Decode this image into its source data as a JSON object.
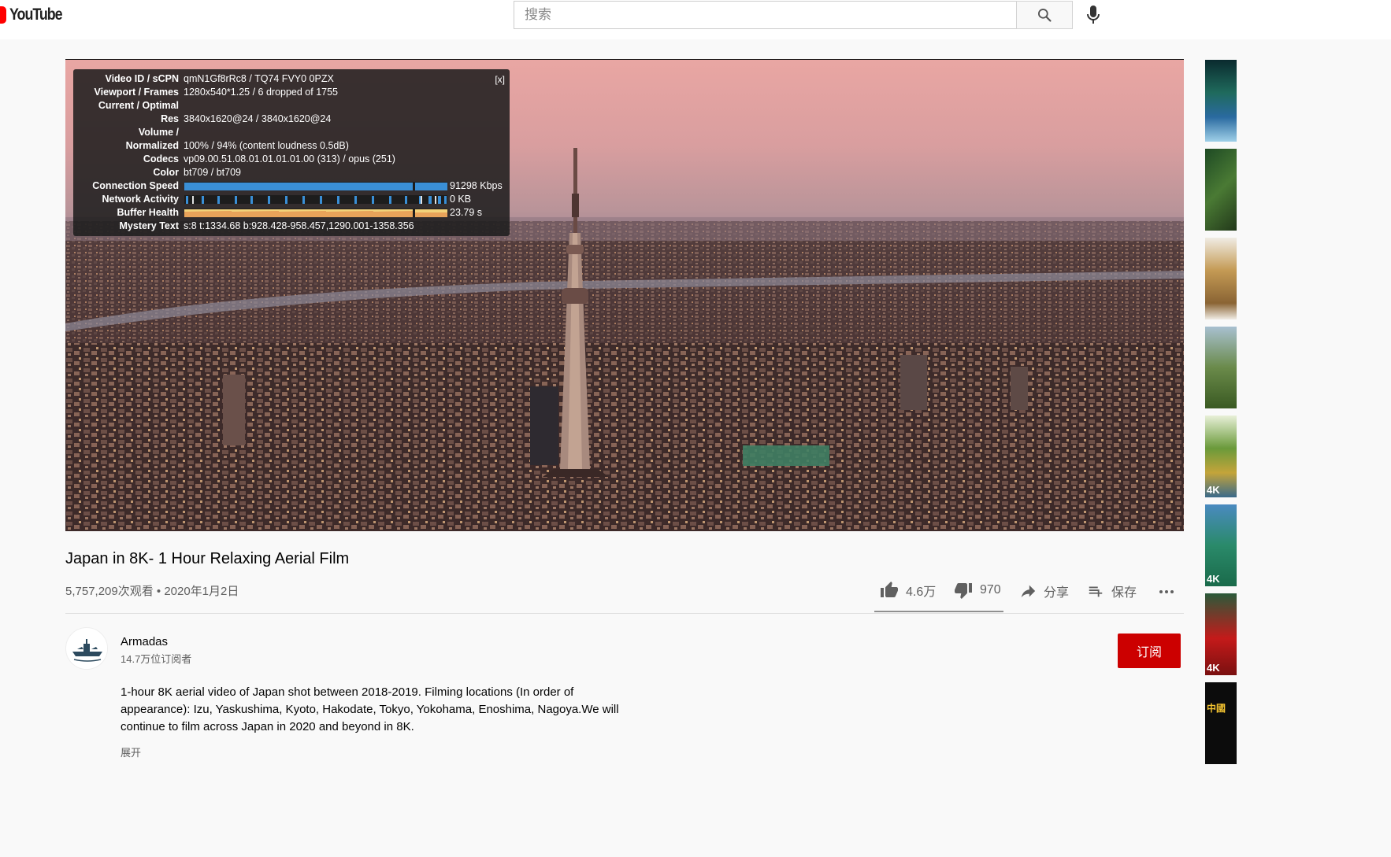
{
  "header": {
    "logo_text": "YouTube",
    "search_placeholder": "搜索",
    "search_icon": "search-icon",
    "mic_icon": "microphone-icon"
  },
  "stats_overlay": {
    "close_label": "[x]",
    "rows": [
      {
        "label": "Video ID / sCPN",
        "value": "qmN1Gf8rRc8 / TQ74 FVY0 0PZX"
      },
      {
        "label": "Viewport / Frames",
        "value": "1280x540*1.25 / 6 dropped of 1755"
      },
      {
        "label": "Current / Optimal",
        "value": ""
      },
      {
        "label": "Res",
        "value": "3840x1620@24 / 3840x1620@24"
      },
      {
        "label": "Volume /",
        "value": ""
      },
      {
        "label": "Normalized",
        "value": "100% / 94% (content loudness 0.5dB)"
      },
      {
        "label": "Codecs",
        "value": "vp09.00.51.08.01.01.01.01.00 (313) / opus (251)"
      },
      {
        "label": "Color",
        "value": "bt709 / bt709"
      },
      {
        "label": "Connection Speed",
        "value": "91298 Kbps"
      },
      {
        "label": "Network Activity",
        "value": "0 KB"
      },
      {
        "label": "Buffer Health",
        "value": "23.79 s"
      },
      {
        "label": "Mystery Text",
        "value": "s:8 t:1334.68 b:928.428-958.457,1290.001-1358.356"
      }
    ]
  },
  "video": {
    "title": "Japan in 8K- 1 Hour Relaxing Aerial Film",
    "meta": "5,757,209次观看 • 2020年1月2日",
    "likes": "4.6万",
    "dislikes": "970",
    "share_label": "分享",
    "save_label": "保存",
    "like_ratio": 0.98
  },
  "channel": {
    "name": "Armadas",
    "subscribers": "14.7万位订阅者",
    "subscribe_label": "订阅"
  },
  "description": {
    "text": "1-hour 8K aerial video of Japan shot between 2018-2019. Filming locations (In order of appearance): Izu, Yaskushima, Kyoto, Hakodate, Tokyo, Yokohama, Enoshima, Nagoya.We will continue to film across Japan in 2020 and beyond in 8K.",
    "more_label": "展开"
  },
  "sidebar_thumbs": [
    {
      "tag": ""
    },
    {
      "tag": ""
    },
    {
      "tag": ""
    },
    {
      "tag": ""
    },
    {
      "tag": "4K"
    },
    {
      "tag": "4K"
    },
    {
      "tag": "4K"
    },
    {
      "tag": "中國"
    }
  ],
  "colors": {
    "brand_red": "#ff0000",
    "subscribe_red": "#cc0000"
  }
}
